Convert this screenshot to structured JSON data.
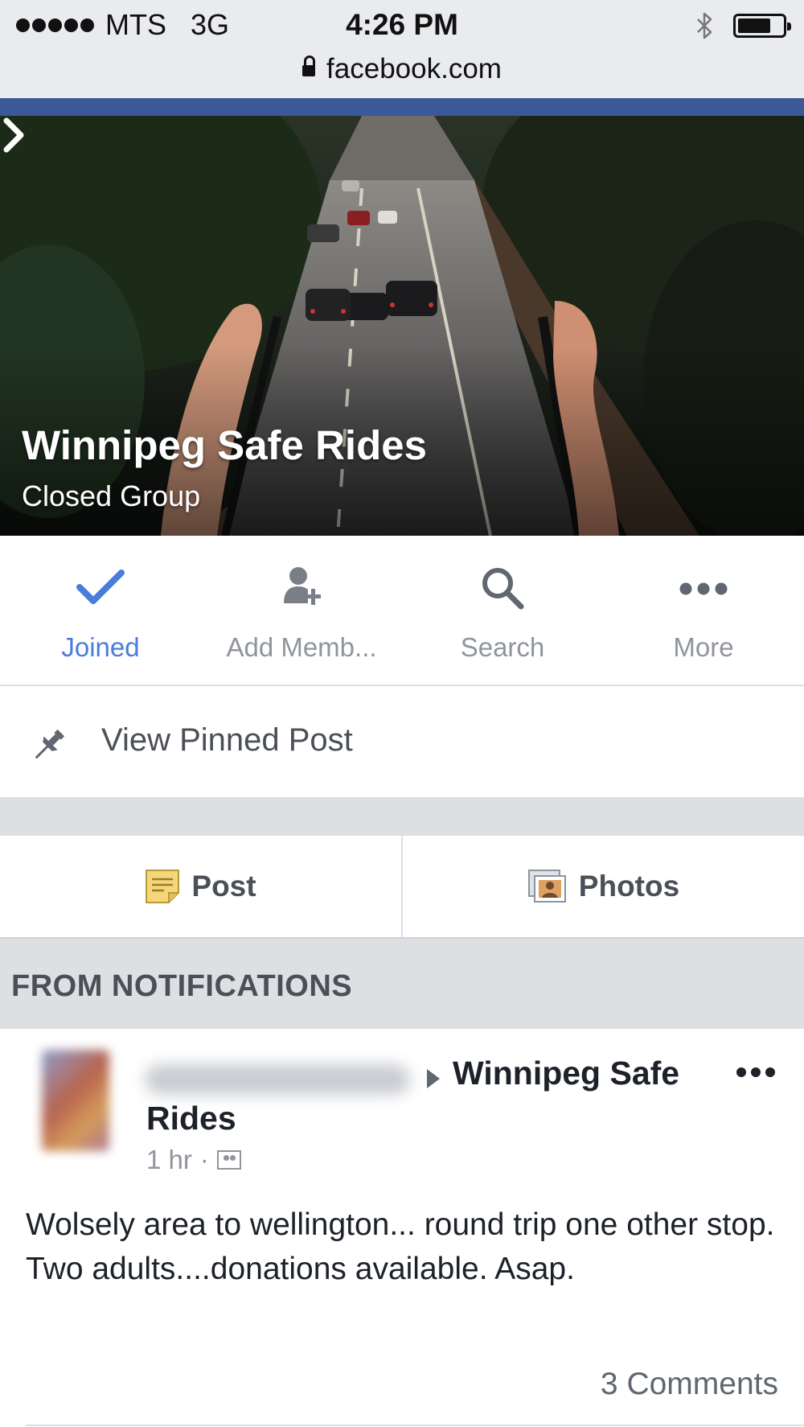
{
  "status_bar": {
    "carrier": "MTS",
    "network": "3G",
    "time": "4:26 PM",
    "url": "facebook.com",
    "icons": [
      "signal-dots-icon",
      "bluetooth-icon",
      "battery-icon",
      "lock-icon"
    ]
  },
  "cover": {
    "group_name": "Winnipeg Safe Rides",
    "group_type": "Closed Group"
  },
  "actions": [
    {
      "label": "Joined",
      "icon": "checkmark-icon",
      "color": "#4a7ddb"
    },
    {
      "label": "Add Memb...",
      "icon": "add-member-icon"
    },
    {
      "label": "Search",
      "icon": "search-icon"
    },
    {
      "label": "More",
      "icon": "more-dots-icon"
    }
  ],
  "pinned": {
    "label": "View Pinned Post",
    "icon": "pin-icon"
  },
  "composer": {
    "post_label": "Post",
    "photos_label": "Photos"
  },
  "section": {
    "label": "FROM NOTIFICATIONS"
  },
  "post": {
    "group_line1": "Winnipeg Safe",
    "group_line2": "Rides",
    "time": "1 hr",
    "separator": "·",
    "body": "Wolsely area to wellington... round trip one other stop. Two adults....donations available. Asap.",
    "comments": "3 Comments"
  },
  "colors": {
    "facebook_blue": "#3b5998",
    "link_blue": "#4a7ddb",
    "gray_text": "#90949c"
  }
}
